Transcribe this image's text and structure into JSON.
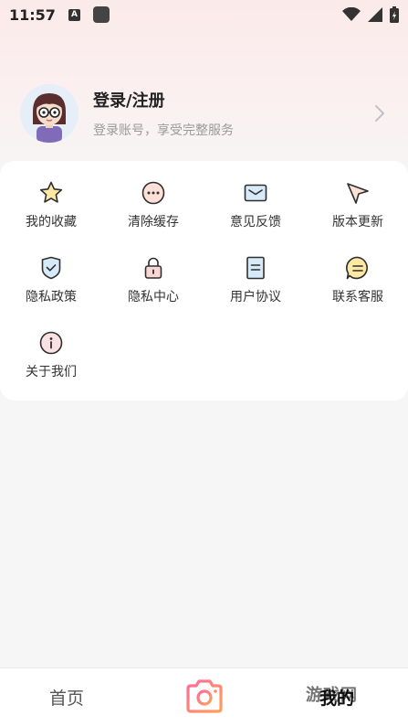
{
  "status_bar": {
    "time": "11:57",
    "notification_icon": "a-notification-icon",
    "app_icon": "app-square-icon",
    "right_icons": [
      "wifi-icon",
      "signal-icon",
      "battery-icon"
    ]
  },
  "profile": {
    "title": "登录/注册",
    "subtitle": "登录账号，享受完整服务",
    "avatar_icon": "girl-avatar-icon",
    "chevron_icon": "chevron-right-icon"
  },
  "menu": [
    {
      "label": "我的收藏",
      "icon": "star-icon"
    },
    {
      "label": "清除缓存",
      "icon": "more-dots-icon"
    },
    {
      "label": "意见反馈",
      "icon": "envelope-icon"
    },
    {
      "label": "版本更新",
      "icon": "send-icon"
    },
    {
      "label": "隐私政策",
      "icon": "shield-icon"
    },
    {
      "label": "隐私中心",
      "icon": "lock-icon"
    },
    {
      "label": "用户协议",
      "icon": "document-icon"
    },
    {
      "label": "联系客服",
      "icon": "chat-icon"
    },
    {
      "label": "关于我们",
      "icon": "info-icon"
    }
  ],
  "bottom_nav": {
    "home_label": "首页",
    "camera_icon": "camera-icon",
    "mine_label": "我的"
  },
  "watermark": "游戏网"
}
